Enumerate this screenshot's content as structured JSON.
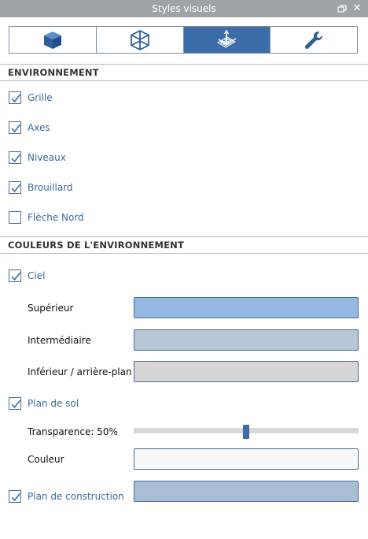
{
  "window": {
    "title": "Styles visuels"
  },
  "tabs": [
    {
      "icon": "solid-cube-icon",
      "active": false
    },
    {
      "icon": "wireframe-cube-icon",
      "active": false
    },
    {
      "icon": "grid-axes-icon",
      "active": true
    },
    {
      "icon": "wrench-icon",
      "active": false
    }
  ],
  "environment": {
    "heading": "ENVIRONNEMENT",
    "items": [
      {
        "label": "Grille",
        "checked": true
      },
      {
        "label": "Axes",
        "checked": true
      },
      {
        "label": "Niveaux",
        "checked": true
      },
      {
        "label": "Brouillard",
        "checked": true
      },
      {
        "label": "Flèche Nord",
        "checked": false
      }
    ]
  },
  "environment_colors": {
    "heading": "COULEURS DE L'ENVIRONNEMENT",
    "sky": {
      "label": "Ciel",
      "checked": true
    },
    "upper": {
      "label": "Supérieur",
      "color": "#94b8e2"
    },
    "middle": {
      "label": "Intermédiaire",
      "color": "#b8c7d6"
    },
    "lower": {
      "label": "Inférieur / arrière-plan",
      "color": "#d6d6d6"
    },
    "ground": {
      "label": "Plan de sol",
      "checked": true
    },
    "transparency": {
      "label": "Transparence: 50%",
      "value": 0.5
    },
    "color": {
      "label": "Couleur",
      "color": "#f8f8f8"
    },
    "construction": {
      "label": "Plan de construction",
      "checked": true,
      "color": "#a7bed6"
    }
  },
  "colors": {
    "accent": "#3b6ea8",
    "link_text": "#3a6aa0"
  }
}
